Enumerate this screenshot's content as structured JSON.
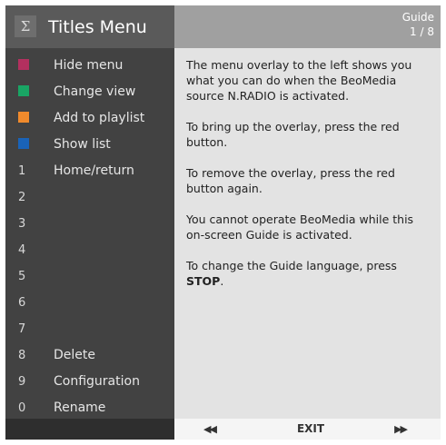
{
  "colors": {
    "red": "#b3305f",
    "green": "#19a564",
    "yellow": "#f08a2c",
    "blue": "#1a63b8",
    "panel_dark": "#424242",
    "panel_light": "#e3e3e3"
  },
  "menu": {
    "sigma_glyph": "Σ",
    "title": "Titles  Menu",
    "items": [
      {
        "key_type": "color",
        "key": "red",
        "label": "Hide menu"
      },
      {
        "key_type": "color",
        "key": "green",
        "label": "Change view"
      },
      {
        "key_type": "color",
        "key": "yellow",
        "label": "Add to playlist"
      },
      {
        "key_type": "color",
        "key": "blue",
        "label": "Show list"
      },
      {
        "key_type": "number",
        "key": "1",
        "label": "Home/return"
      },
      {
        "key_type": "number",
        "key": "2",
        "label": ""
      },
      {
        "key_type": "number",
        "key": "3",
        "label": ""
      },
      {
        "key_type": "number",
        "key": "4",
        "label": ""
      },
      {
        "key_type": "number",
        "key": "5",
        "label": ""
      },
      {
        "key_type": "number",
        "key": "6",
        "label": ""
      },
      {
        "key_type": "number",
        "key": "7",
        "label": ""
      },
      {
        "key_type": "number",
        "key": "8",
        "label": "Delete"
      },
      {
        "key_type": "number",
        "key": "9",
        "label": "Configuration"
      },
      {
        "key_type": "number",
        "key": "0",
        "label": "Rename"
      }
    ]
  },
  "guide": {
    "label": "Guide",
    "page": "1 / 8",
    "paragraphs": [
      {
        "text": "The menu overlay to the left shows you what you can do when the BeoMedia source N.RADIO is activated."
      },
      {
        "text": "To bring up the overlay, press the red button."
      },
      {
        "text": "To remove the overlay, press the red button again."
      },
      {
        "text": "You cannot operate BeoMedia while this on-screen Guide is activated."
      },
      {
        "text": "To change the Guide language, press ",
        "bold": "STOP",
        "after": "."
      }
    ],
    "nav": {
      "prev": "◀◀",
      "exit": "EXIT",
      "next": "▶▶"
    }
  }
}
